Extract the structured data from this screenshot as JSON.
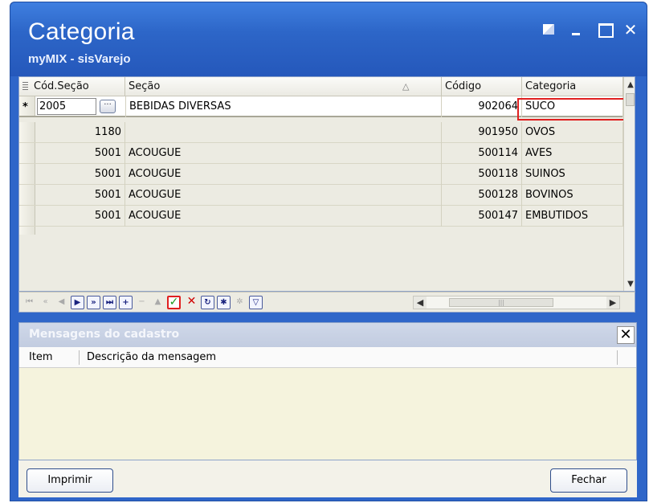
{
  "window": {
    "title": "Categoria",
    "subtitle": "myMIX - sisVarejo",
    "controls": {
      "close_glyph": "✕"
    }
  },
  "grid": {
    "columns": [
      "Cód.Seção",
      "Seção",
      "Código",
      "Categoria"
    ],
    "sort_indicator": "△",
    "new_row": {
      "marker": "*",
      "cod_secao": "2005",
      "ellipsis": "···",
      "secao": "BEBIDAS DIVERSAS",
      "codigo": "902064",
      "categoria": "SUCO"
    },
    "rows": [
      {
        "cod_secao": "1180",
        "secao": "",
        "codigo": "901950",
        "categoria": "OVOS"
      },
      {
        "cod_secao": "5001",
        "secao": "ACOUGUE",
        "codigo": "500114",
        "categoria": "AVES"
      },
      {
        "cod_secao": "5001",
        "secao": "ACOUGUE",
        "codigo": "500118",
        "categoria": "SUINOS"
      },
      {
        "cod_secao": "5001",
        "secao": "ACOUGUE",
        "codigo": "500128",
        "categoria": "BOVINOS"
      },
      {
        "cod_secao": "5001",
        "secao": "ACOUGUE",
        "codigo": "500147",
        "categoria": "EMBUTIDOS"
      }
    ],
    "scroll_up": "▲",
    "scroll_down": "▼"
  },
  "navigator": {
    "first": "⏮",
    "prev_page": "«",
    "prev": "◀",
    "next": "▶",
    "next_page": "»",
    "last": "⏭",
    "insert": "+",
    "delete": "−",
    "edit": "▲",
    "post": "✓",
    "cancel": "✕",
    "refresh": "↻",
    "apply": "✱",
    "dismiss": "✲",
    "filter": "▽",
    "hs_left": "◀",
    "hs_right": "▶",
    "hs_thumb": "|||"
  },
  "messages": {
    "title": "Mensagens do cadastro",
    "close": "✕",
    "col_item": "Item",
    "col_desc": "Descrição da mensagem"
  },
  "footer": {
    "print_label": "Imprimir",
    "close_label": "Fechar"
  }
}
